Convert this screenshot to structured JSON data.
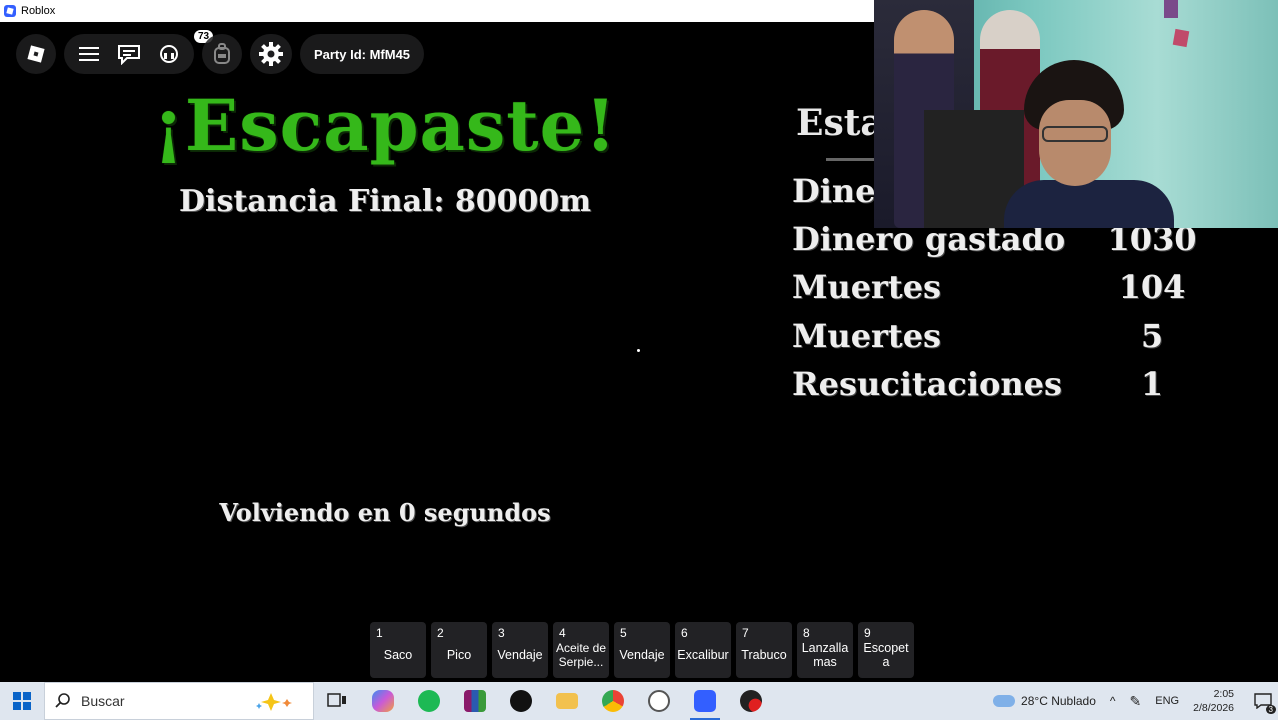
{
  "window": {
    "title": "Roblox"
  },
  "hud": {
    "chat_badge": "73",
    "party_label": "Party Id: MfM45"
  },
  "result": {
    "title": "¡Escapaste!",
    "final_distance": "Distancia Final: 80000m",
    "returning": "Volviendo en 0 segundos"
  },
  "stats": {
    "title": "Esta",
    "rows": [
      {
        "label": "Diner",
        "value": ""
      },
      {
        "label": "Dinero gastado",
        "value": "1030"
      },
      {
        "label": "Muertes",
        "value": "104"
      },
      {
        "label": "Muertes",
        "value": "5"
      },
      {
        "label": "Resucitaciones",
        "value": "1"
      }
    ]
  },
  "hotbar": [
    {
      "num": "1",
      "name": "Saco"
    },
    {
      "num": "2",
      "name": "Pico"
    },
    {
      "num": "3",
      "name": "Vendaje"
    },
    {
      "num": "4",
      "name": "Aceite de Serpie..."
    },
    {
      "num": "5",
      "name": "Vendaje"
    },
    {
      "num": "6",
      "name": "Excalibur"
    },
    {
      "num": "7",
      "name": "Trabuco"
    },
    {
      "num": "8",
      "name": "Lanzallamas"
    },
    {
      "num": "9",
      "name": "Escopeta"
    }
  ],
  "taskbar": {
    "search_placeholder": "Buscar",
    "apps": [
      "task-view-icon",
      "copilot-icon",
      "spotify-icon",
      "winrar-icon",
      "tiktok-icon",
      "file-explorer-icon",
      "chrome-icon",
      "clock-app-icon",
      "roblox-icon",
      "record-icon"
    ],
    "weather": "28°C  Nublado",
    "language": "ENG",
    "time": "2:05",
    "date": "2/8/2026",
    "notifications": "3"
  },
  "colors": {
    "title_green": "#35b81a",
    "taskbar_bg": "#dfe6ef",
    "hud_bg": "#1e1e20"
  }
}
